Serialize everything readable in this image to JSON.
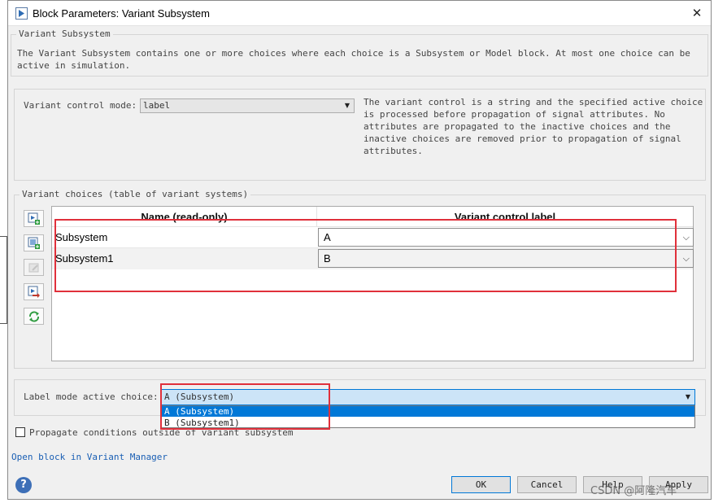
{
  "window": {
    "title": "Block Parameters: Variant Subsystem",
    "close_glyph": "✕"
  },
  "header_group": {
    "legend": "Variant Subsystem",
    "description_line1": "The Variant Subsystem contains one or more choices where each choice is a Subsystem or Model block. At most one choice can be",
    "description_line2": "active in simulation."
  },
  "control_mode": {
    "label": "Variant control mode:",
    "value": "label",
    "help_lines": [
      "The variant control is a string and the specified active choice",
      "is processed before propagation of signal attributes. No",
      "attributes are propagated to the inactive choices and the",
      "inactive choices are removed prior to propagation of signal",
      "attributes."
    ]
  },
  "choices_group": {
    "legend": "Variant choices (table of variant systems)",
    "toolbar": [
      {
        "icon": "add-subsystem-icon"
      },
      {
        "icon": "add-model-icon"
      },
      {
        "icon": "edit-disabled-icon"
      },
      {
        "icon": "open-block-icon"
      },
      {
        "icon": "refresh-icon"
      }
    ],
    "columns": [
      "Name (read-only)",
      "Variant control label"
    ],
    "rows": [
      {
        "name": "Subsystem",
        "label": "A"
      },
      {
        "name": "Subsystem1",
        "label": "B"
      }
    ]
  },
  "active_choice": {
    "label": "Label mode active choice:",
    "value": "A (Subsystem)",
    "options": [
      "A (Subsystem)",
      "B (Subsystem1)"
    ]
  },
  "propagate": {
    "label": "Propagate conditions outside of variant subsystem",
    "checked": false
  },
  "links": {
    "variant_manager": "Open block in Variant Manager"
  },
  "buttons": {
    "ok": "OK",
    "cancel": "Cancel",
    "help": "Help",
    "apply": "Apply"
  },
  "watermark": "CSDN @阿隆汽车",
  "colors": {
    "highlight_red": "#e0303b",
    "selection_blue": "#0078d7",
    "link_blue": "#1a5fb4"
  }
}
